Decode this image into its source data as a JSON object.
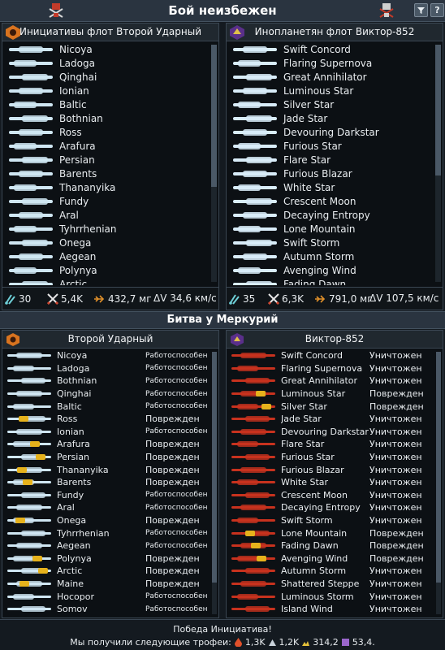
{
  "window": {
    "title": "Бой неизбежен",
    "buttons": [
      "filter-button",
      "help-button"
    ],
    "help_label": "?"
  },
  "player_fleet": {
    "title": "Инициативы флот Второй Ударный",
    "ships": [
      "Nicoya",
      "Ladoga",
      "Qinghai",
      "Ionian",
      "Baltic",
      "Bothnian",
      "Ross",
      "Arafura",
      "Persian",
      "Barents",
      "Thananyika",
      "Fundy",
      "Aral",
      "Tyhrrhenian",
      "Onega",
      "Aegean",
      "Polynya",
      "Arctic"
    ],
    "stats": {
      "ships": "30",
      "power": "5,4K",
      "mass": "432,7 мг",
      "dv": "ΔV 34,6 км/с"
    }
  },
  "enemy_fleet": {
    "title": "Инопланетян флот Виктор-852",
    "ships": [
      "Swift Concord",
      "Flaring Supernova",
      "Great Annihilator",
      "Luminous Star",
      "Silver Star",
      "Jade Star",
      "Devouring Darkstar",
      "Furious Star",
      "Flare Star",
      "Furious Blazar",
      "White Star",
      "Crescent Moon",
      "Decaying Entropy",
      "Lone Mountain",
      "Swift Storm",
      "Autumn Storm",
      "Avenging Wind",
      "Fading Dawn"
    ],
    "stats": {
      "ships": "35",
      "power": "6,3K",
      "mass": "791,0 мг",
      "dv": "ΔV 107,5 км/с"
    }
  },
  "battle": {
    "title": "Битва у Меркурий",
    "left": {
      "title": "Второй Ударный",
      "rows": [
        {
          "name": "Nicoya",
          "status": "Работоспособен",
          "state": "ok"
        },
        {
          "name": "Ladoga",
          "status": "Работоспособен",
          "state": "ok"
        },
        {
          "name": "Bothnian",
          "status": "Работоспособен",
          "state": "ok"
        },
        {
          "name": "Qinghai",
          "status": "Работоспособен",
          "state": "ok"
        },
        {
          "name": "Baltic",
          "status": "Работоспособен",
          "state": "ok"
        },
        {
          "name": "Ross",
          "status": "Поврежден",
          "state": "dmg"
        },
        {
          "name": "Ionian",
          "status": "Работоспособен",
          "state": "ok"
        },
        {
          "name": "Arafura",
          "status": "Поврежден",
          "state": "dmg"
        },
        {
          "name": "Persian",
          "status": "Поврежден",
          "state": "dmg"
        },
        {
          "name": "Thananyika",
          "status": "Поврежден",
          "state": "dmg"
        },
        {
          "name": "Barents",
          "status": "Поврежден",
          "state": "dmg"
        },
        {
          "name": "Fundy",
          "status": "Работоспособен",
          "state": "ok"
        },
        {
          "name": "Aral",
          "status": "Работоспособен",
          "state": "ok"
        },
        {
          "name": "Onega",
          "status": "Поврежден",
          "state": "dmg"
        },
        {
          "name": "Tyhrrhenian",
          "status": "Работоспособен",
          "state": "ok"
        },
        {
          "name": "Aegean",
          "status": "Работоспособен",
          "state": "ok"
        },
        {
          "name": "Polynya",
          "status": "Поврежден",
          "state": "dmg"
        },
        {
          "name": "Arctic",
          "status": "Поврежден",
          "state": "dmg"
        },
        {
          "name": "Maine",
          "status": "Поврежден",
          "state": "dmg"
        },
        {
          "name": "Hocopor",
          "status": "Работоспособен",
          "state": "ok"
        },
        {
          "name": "Somov",
          "status": "Работоспособен",
          "state": "ok"
        }
      ]
    },
    "right": {
      "title": "Виктор-852",
      "rows": [
        {
          "name": "Swift Concord",
          "status": "Уничтожен",
          "state": "dead"
        },
        {
          "name": "Flaring Supernova",
          "status": "Уничтожен",
          "state": "dead"
        },
        {
          "name": "Great Annihilator",
          "status": "Уничтожен",
          "state": "dead"
        },
        {
          "name": "Luminous Star",
          "status": "Поврежден",
          "state": "dmg"
        },
        {
          "name": "Silver Star",
          "status": "Поврежден",
          "state": "dmg"
        },
        {
          "name": "Jade Star",
          "status": "Уничтожен",
          "state": "dead"
        },
        {
          "name": "Devouring Darkstar",
          "status": "Уничтожен",
          "state": "dead"
        },
        {
          "name": "Flare Star",
          "status": "Уничтожен",
          "state": "dead"
        },
        {
          "name": "Furious Star",
          "status": "Уничтожен",
          "state": "dead"
        },
        {
          "name": "Furious Blazar",
          "status": "Уничтожен",
          "state": "dead"
        },
        {
          "name": "White Star",
          "status": "Уничтожен",
          "state": "dead"
        },
        {
          "name": "Crescent Moon",
          "status": "Уничтожен",
          "state": "dead"
        },
        {
          "name": "Decaying Entropy",
          "status": "Уничтожен",
          "state": "dead"
        },
        {
          "name": "Swift Storm",
          "status": "Уничтожен",
          "state": "dead"
        },
        {
          "name": "Lone Mountain",
          "status": "Поврежден",
          "state": "dmg"
        },
        {
          "name": "Fading Dawn",
          "status": "Поврежден",
          "state": "dmg"
        },
        {
          "name": "Avenging Wind",
          "status": "Поврежден",
          "state": "dmg"
        },
        {
          "name": "Autumn Storm",
          "status": "Уничтожен",
          "state": "dead"
        },
        {
          "name": "Shattered Steppe",
          "status": "Уничтожен",
          "state": "dead"
        },
        {
          "name": "Luminous Storm",
          "status": "Уничтожен",
          "state": "dead"
        },
        {
          "name": "Island Wind",
          "status": "Уничтожен",
          "state": "dead"
        }
      ]
    }
  },
  "result": {
    "headline": "Победа Инициатива!",
    "trophies_label": "Мы получили следующие трофеи:",
    "trophies": [
      {
        "icon": "fuel-drop-icon",
        "value": "1,3K",
        "color": "#e0502a"
      },
      {
        "icon": "metal-icon",
        "value": "1,2K",
        "color": "#c9d2da"
      },
      {
        "icon": "volatiles-icon",
        "value": "314,2",
        "color": "#e6c23a"
      },
      {
        "icon": "exotics-icon",
        "value": "53,4.",
        "color": "#9a66cc"
      }
    ]
  },
  "colors": {
    "player_ship": "#cfe6f2",
    "enemy_ship_light": "#d8ecf8",
    "enemy_ship_red": "#c8321e",
    "damage": "#e6b21c"
  }
}
